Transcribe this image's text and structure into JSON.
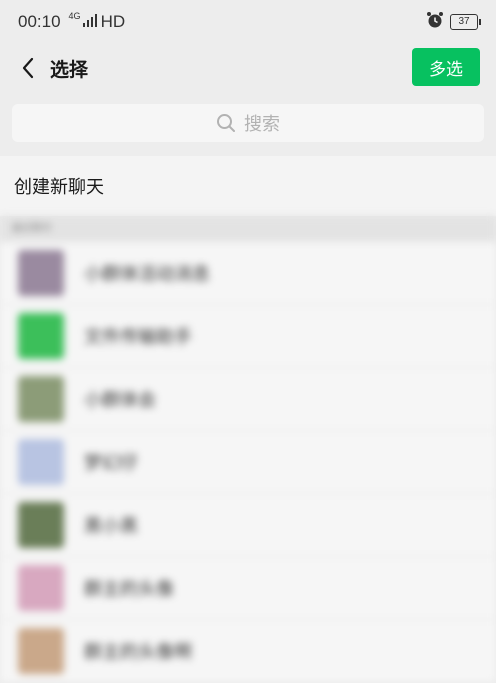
{
  "status": {
    "time": "00:10",
    "network": "4G",
    "hd": "HD",
    "battery": "37"
  },
  "nav": {
    "title": "选择",
    "multi_select": "多选"
  },
  "search": {
    "placeholder": "搜索"
  },
  "new_chat": "创建新聊天",
  "section": {
    "title": "最近聊天"
  },
  "chats": [
    {
      "name": "小群体活动消息",
      "avatar_color": "#9a8aa0"
    },
    {
      "name": "文件传输助手",
      "avatar_color": "#3cbf5a"
    },
    {
      "name": "小群体会",
      "avatar_color": "#8c9c78"
    },
    {
      "name": "梦幻仔",
      "avatar_color": "#b8c4e2"
    },
    {
      "name": "黑小黑",
      "avatar_color": "#6a7e58"
    },
    {
      "name": "群主的头像",
      "avatar_color": "#d8a8c0"
    },
    {
      "name": "群主的头像啊",
      "avatar_color": "#caa88a"
    }
  ],
  "colors": {
    "accent": "#07c160",
    "background": "#ededed"
  }
}
